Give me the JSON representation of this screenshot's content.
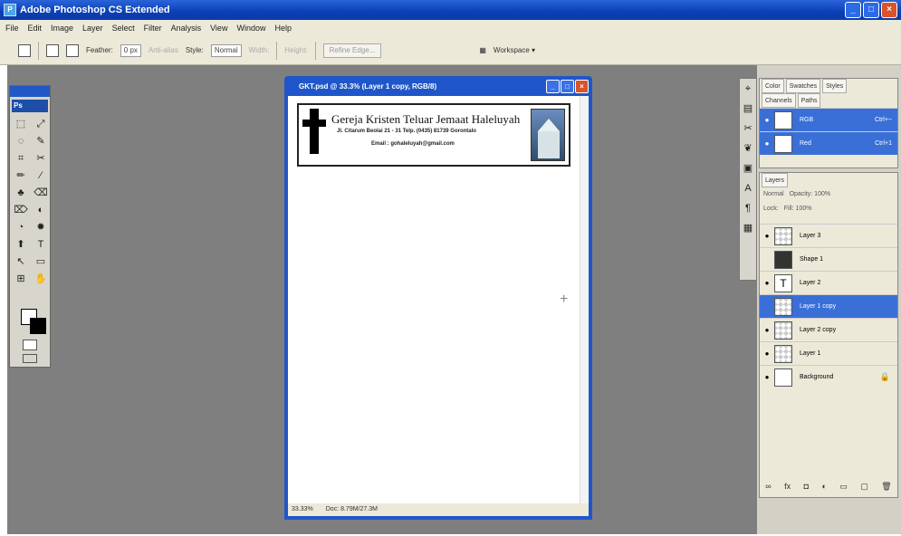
{
  "app": {
    "title": "Adobe Photoshop CS Extended"
  },
  "window_buttons": [
    "_",
    "□",
    "×"
  ],
  "menu": [
    "File",
    "Edit",
    "Image",
    "Layer",
    "Select",
    "Filter",
    "Analysis",
    "View",
    "Window",
    "Help"
  ],
  "options": {
    "feather_label": "Feather:",
    "feather_value": "0 px",
    "antialias_label": "Anti-alias",
    "style_label": "Style:",
    "style_value": "Normal",
    "width_label": "Width:",
    "height_label": "Height:",
    "refine_label": "Refine Edge...",
    "workspace_label": "Workspace ▾"
  },
  "toolbox": {
    "logo": "Ps",
    "tools": [
      "⬚",
      "⤢",
      "◌",
      "✎",
      "⌗",
      "✂",
      "✏",
      "⁄",
      "♣",
      "⌫",
      "⌦",
      "◐",
      "◔",
      "✹",
      "⬆",
      "T",
      "↖",
      "▭",
      "⊞",
      "✋",
      "⌕",
      ""
    ]
  },
  "document": {
    "title": "GKT.psd @ 33.3% (Layer 1 copy, RGB/8)",
    "status_zoom": "33.33%",
    "status_doc": "Doc: 8.79M/27.3M",
    "letterhead": {
      "title": "Gereja Kristen Teluar Jemaat Haleluyah",
      "address": "Jl. Citarum Beolai 21 - 31 Telp. (0435) 81739 Gorontalo",
      "email": "Email : gohaleluyah@gmail.com"
    }
  },
  "iconstrip": [
    "⌖",
    "▤",
    "✂",
    "❦",
    "▣",
    "A",
    "¶",
    "▦"
  ],
  "channels_panel": {
    "tabs": [
      "Color",
      "Swatches",
      "Styles"
    ],
    "subtabs": [
      "Channels",
      "Paths"
    ],
    "rows": [
      {
        "name": "RGB",
        "shortcut": "Ctrl+~",
        "selected": true
      },
      {
        "name": "Red",
        "shortcut": "Ctrl+1",
        "selected": true
      }
    ]
  },
  "layers_panel": {
    "tab": "Layers",
    "blend": "Normal",
    "opacity": "Opacity: 100%",
    "lock": "Lock:",
    "fill": "Fill: 100%",
    "layers": [
      {
        "name": "Layer 3",
        "thumb": "checker",
        "selected": false,
        "extra": ""
      },
      {
        "name": "Shape 1",
        "thumb": "shape",
        "selected": false,
        "extra": ""
      },
      {
        "name": "Layer 2",
        "thumb": "text",
        "selected": false,
        "extra": ""
      },
      {
        "name": "Layer 1 copy",
        "thumb": "checker",
        "selected": true,
        "extra": ""
      },
      {
        "name": "Layer 2 copy",
        "thumb": "checker",
        "selected": false,
        "extra": ""
      },
      {
        "name": "Layer 1",
        "thumb": "checker",
        "selected": false,
        "extra": ""
      },
      {
        "name": "Background",
        "thumb": "white",
        "selected": false,
        "extra": "🔒"
      }
    ],
    "bottom_icons": [
      "∞",
      "fx",
      "◘",
      "◐",
      "▭",
      "▢",
      "🗑"
    ]
  },
  "colors": {
    "titlebar": "#0a3fb5",
    "selection": "#3a6fd8",
    "workspace": "#7f7f7f"
  }
}
